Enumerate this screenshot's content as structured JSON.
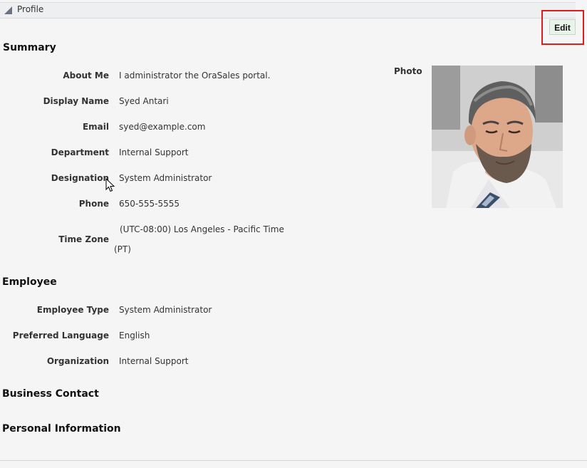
{
  "panel": {
    "title": "Profile",
    "edit_label": "Edit"
  },
  "summary": {
    "title": "Summary",
    "about_me": {
      "label": "About Me",
      "value": "I administrator the OraSales portal."
    },
    "display_name": {
      "label": "Display Name",
      "value": "Syed Antari"
    },
    "email": {
      "label": "Email",
      "value": "syed@example.com"
    },
    "department": {
      "label": "Department",
      "value": "Internal Support"
    },
    "designation": {
      "label": "Designation",
      "value": "System Administrator"
    },
    "phone": {
      "label": "Phone",
      "value": "650-555-5555"
    },
    "time_zone": {
      "label": "Time Zone",
      "value_line1": "(UTC-08:00) Los Angeles - Pacific Time",
      "value_line2": "(PT)"
    },
    "photo_label": "Photo"
  },
  "employee": {
    "title": "Employee",
    "employee_type": {
      "label": "Employee Type",
      "value": "System Administrator"
    },
    "preferred_language": {
      "label": "Preferred Language",
      "value": "English"
    },
    "organization": {
      "label": "Organization",
      "value": "Internal Support"
    }
  },
  "business_contact": {
    "title": "Business Contact"
  },
  "personal_information": {
    "title": "Personal Information"
  },
  "colors": {
    "highlight": "#e01c1c",
    "edit_button_bg": "#e8f3ea",
    "page_bg": "#f5f5f5"
  }
}
